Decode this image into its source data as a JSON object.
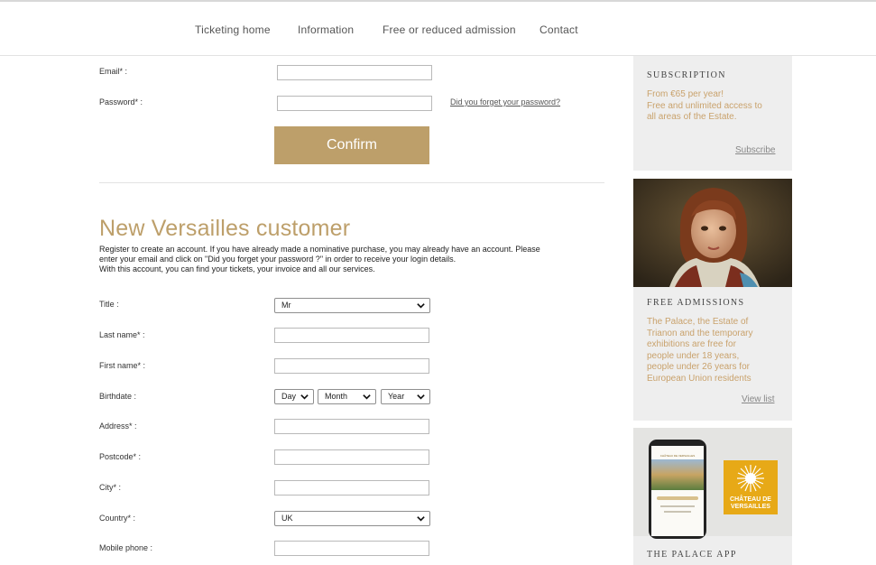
{
  "nav": {
    "items": [
      {
        "label": "Ticketing home"
      },
      {
        "label": "Information"
      },
      {
        "label": "Free or reduced admission"
      },
      {
        "label": "Contact"
      }
    ]
  },
  "login": {
    "email_label": "Email* :",
    "email_value": "",
    "password_label": "Password* :",
    "password_value": "",
    "forgot_link": "Did you forget your password?",
    "confirm_button": "Confirm"
  },
  "register": {
    "heading": "New Versailles customer",
    "intro_lines": [
      "Register to create an account. If you have already made a nominative purchase, you may already have an account. Please",
      "enter your email and click on \"Did you forget your password ?\" in order to receive your login details.",
      "With this account, you can find your tickets, your invoice and all our services."
    ],
    "title_label": "Title :",
    "title_value": "Mr",
    "last_name_label": "Last name* :",
    "first_name_label": "First name* :",
    "birthdate_label": "Birthdate :",
    "birth_day": "Day",
    "birth_month": "Month",
    "birth_year": "Year",
    "address_label": "Address* :",
    "postcode_label": "Postcode* :",
    "city_label": "City* :",
    "country_label": "Country* :",
    "country_value": "UK",
    "mobile_label": "Mobile phone :"
  },
  "sidebar": {
    "subscription": {
      "title": "SUBSCRIPTION",
      "lines": [
        "From €65 per year!",
        "Free and unlimited access to",
        "all areas of the Estate."
      ],
      "link": "Subscribe"
    },
    "free_admissions": {
      "title": "FREE ADMISSIONS",
      "lines": [
        "The Palace, the Estate of",
        "Trianon and the temporary",
        "exhibitions are free for",
        "people under 18 years,",
        "people under 26 years for",
        "European Union residents"
      ],
      "link": "View list"
    },
    "app": {
      "title": "THE PALACE APP",
      "logo_lines": [
        "CHÂTEAU DE",
        "VERSAILLES"
      ],
      "phone_header": "CHÂTEAU DE VERSAILLES"
    }
  },
  "colors": {
    "accent_gold": "#bd9f6a",
    "sidebar_bg": "#eeeeee",
    "sidebar_text_gold": "#c9a26c",
    "logo_yellow": "#e7a917"
  }
}
